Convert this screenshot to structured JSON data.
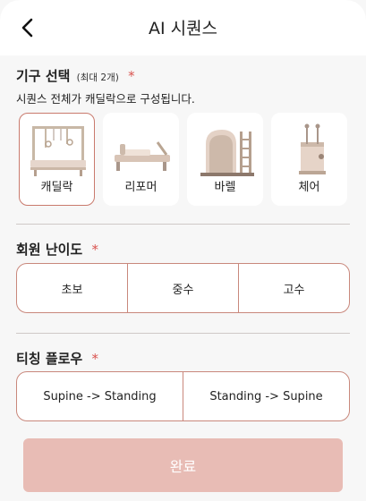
{
  "header": {
    "title": "AI 시퀀스",
    "back_icon": "chevron-left-icon"
  },
  "equipment": {
    "title": "기구 선택",
    "subtitle": "(최대 2개)",
    "required_mark": "*",
    "description": "시퀀스 전체가 캐딜락으로 구성됩니다.",
    "selected": "캐딜락",
    "items": [
      {
        "label": "캐딜락",
        "icon": "cadillac-icon"
      },
      {
        "label": "리포머",
        "icon": "reformer-icon"
      },
      {
        "label": "바렐",
        "icon": "barrel-icon"
      },
      {
        "label": "체어",
        "icon": "chair-icon"
      }
    ]
  },
  "difficulty": {
    "title": "회원 난이도",
    "required_mark": "*",
    "options": [
      "초보",
      "중수",
      "고수"
    ]
  },
  "flow": {
    "title": "티칭 플로우",
    "required_mark": "*",
    "options": [
      "Supine -> Standing",
      "Standing -> Supine"
    ]
  },
  "complete_button": {
    "label": "완료"
  },
  "colors": {
    "accent": "#c9887c",
    "button_disabled": "#e8bcb5",
    "required": "#d9534f"
  }
}
